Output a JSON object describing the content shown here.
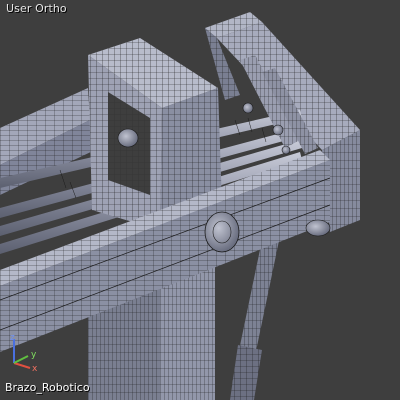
{
  "viewport": {
    "view_label": "User Ortho",
    "object_label": "Brazo_Robotico"
  },
  "gizmo": {
    "x_label": "x",
    "y_label": "y",
    "z_label": "z",
    "x_color": "#e05040",
    "y_color": "#60c040",
    "z_color": "#4a70e0"
  },
  "colors": {
    "background": "#3e3e3e",
    "mesh_face": "#8d92a6",
    "mesh_face_light": "#a2a6b8",
    "mesh_face_dark": "#6c7082",
    "wire": "#1a1a1a"
  }
}
